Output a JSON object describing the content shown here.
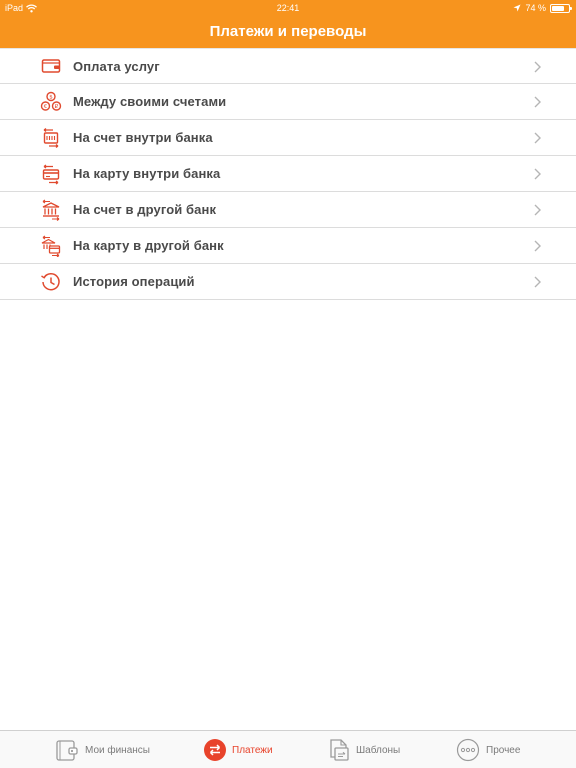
{
  "status_bar": {
    "carrier": "iPad",
    "time": "22:41",
    "battery": "74 %",
    "battery_level": 0.74
  },
  "header": {
    "title": "Платежи и переводы"
  },
  "menu": {
    "items": [
      {
        "label": "Оплата услуг",
        "icon": "wallet-icon"
      },
      {
        "label": "Между своими счетами",
        "icon": "currency-exchange-icon"
      },
      {
        "label": "На счет внутри банка",
        "icon": "account-transfer-icon"
      },
      {
        "label": "На карту внутри банка",
        "icon": "card-transfer-icon"
      },
      {
        "label": "На счет в другой банк",
        "icon": "bank-account-transfer-icon"
      },
      {
        "label": "На карту в другой банк",
        "icon": "bank-card-transfer-icon"
      },
      {
        "label": "История операций",
        "icon": "history-clock-icon"
      }
    ]
  },
  "tabbar": {
    "tabs": [
      {
        "label": "Мои финансы",
        "icon": "wallet-icon",
        "active": false
      },
      {
        "label": "Платежи",
        "icon": "transfer-arrows-icon",
        "active": true
      },
      {
        "label": "Шаблоны",
        "icon": "templates-icon",
        "active": false
      },
      {
        "label": "Прочее",
        "icon": "more-dots-icon",
        "active": false
      }
    ]
  },
  "colors": {
    "accent": "#f7941e",
    "active_tab": "#e8432b",
    "icon_red": "#e04a2f"
  }
}
